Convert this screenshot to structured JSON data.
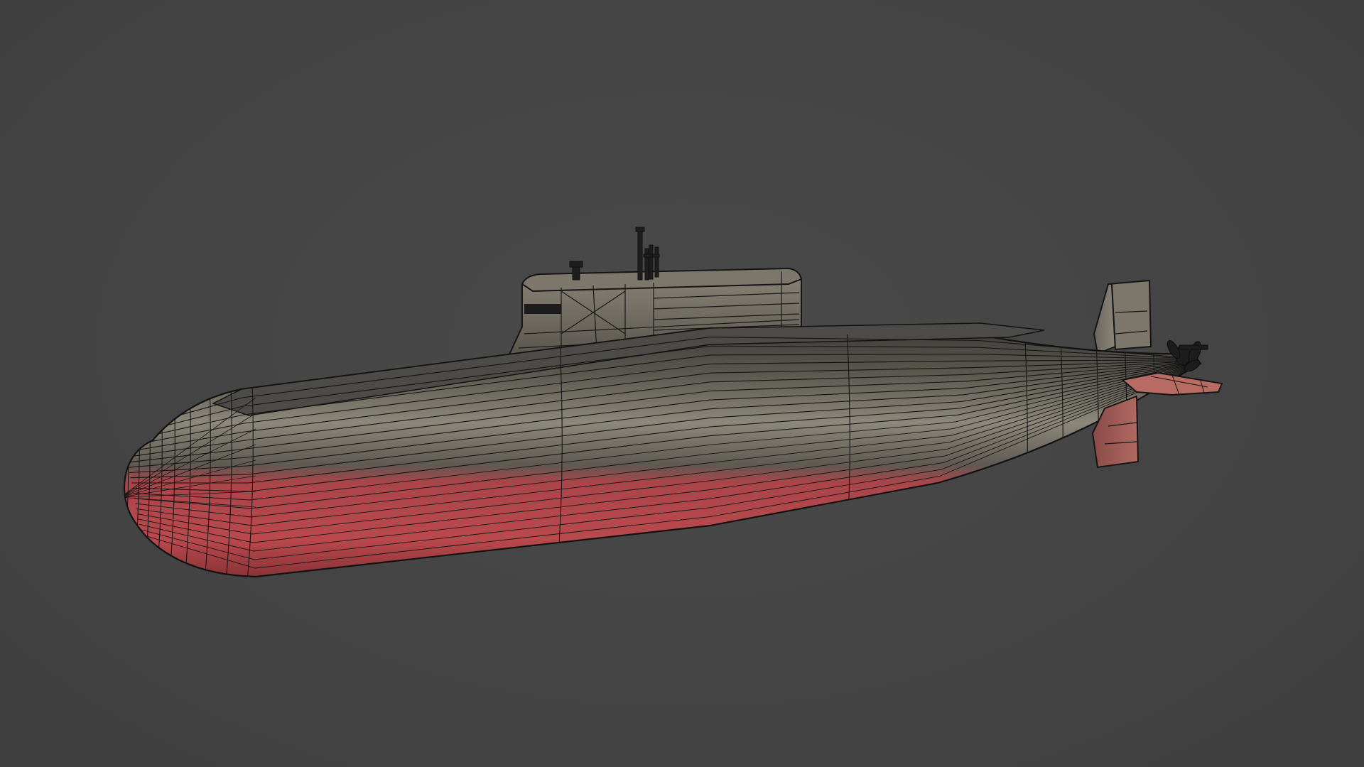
{
  "viewport": {
    "background": "#444444"
  },
  "model": {
    "subject": "submarine-icon",
    "display_mode": "textured-wireframe",
    "colors": {
      "hull_upper": "#55534d",
      "hull_highlight": "#8a857a",
      "hull_lower": "#b5484b",
      "hull_lower_shade": "#7e2f33",
      "wire": "#141414",
      "sail": "#6f6a60"
    }
  }
}
